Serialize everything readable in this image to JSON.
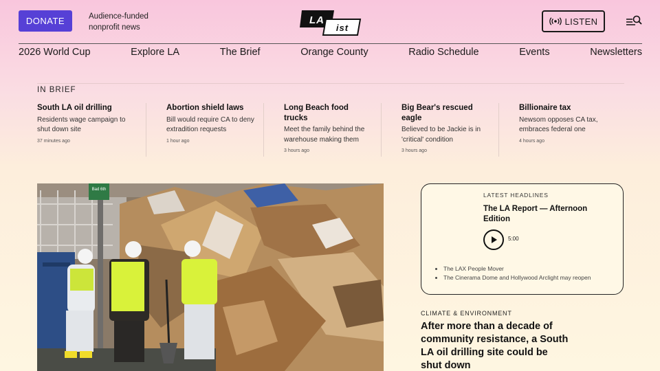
{
  "header": {
    "donate_label": "DONATE",
    "tagline_line1": "Audience-funded",
    "tagline_line2": "nonprofit news",
    "logo_text_1": "LA",
    "logo_text_2": "ist",
    "listen_label": "LISTEN"
  },
  "nav": {
    "items": [
      "2026 World Cup",
      "Explore LA",
      "The Brief",
      "Orange County",
      "Radio Schedule",
      "Events",
      "Newsletters"
    ]
  },
  "in_brief": {
    "label": "IN BRIEF",
    "items": [
      {
        "title": "South LA oil drilling",
        "summary": "Residents wage campaign to shut down site",
        "time": "37 minutes ago"
      },
      {
        "title": "Abortion shield laws",
        "summary": "Bill would require CA to deny extradition requests",
        "time": "1 hour ago"
      },
      {
        "title": "Long Beach food trucks",
        "summary": "Meet the family behind the warehouse making them",
        "time": "3 hours ago"
      },
      {
        "title": "Big Bear's rescued eagle",
        "summary": "Believed to be Jackie is in 'critical' condition",
        "time": "3 hours ago"
      },
      {
        "title": "Billionaire tax",
        "summary": "Newsom opposes CA tax, embraces federal one",
        "time": "4 hours ago"
      }
    ]
  },
  "latest": {
    "label": "LATEST HEADLINES",
    "headline": "The LA Report — Afternoon Edition",
    "duration": "5:00",
    "bullets": [
      "The LAX People Mover",
      "The Cinerama Dome and Hollywood Arclight may reopen"
    ]
  },
  "story": {
    "category": "CLIMATE & ENVIRONMENT",
    "title": "After more than a decade of community resistance, a South LA oil drilling site could be shut down"
  },
  "photo": {
    "sign_text": "Bad 6th"
  },
  "colors": {
    "donate": "#5640d6",
    "vest": "#d9f23a"
  }
}
